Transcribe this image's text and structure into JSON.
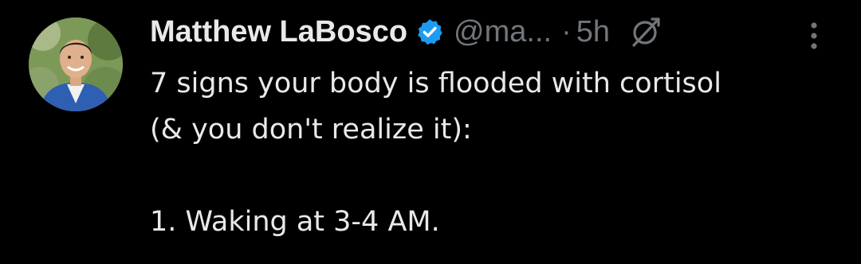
{
  "tweet": {
    "author": {
      "display_name": "Matthew LaBosco",
      "handle": "@ma...",
      "verified": true,
      "avatar_icon": "profile-photo-avatar"
    },
    "separator": "·",
    "time": "5h",
    "grok_icon": "grok-icon",
    "more_icon": "more-vertical-icon",
    "text_lines": [
      "7 signs your body is flooded with cortisol",
      "(& you don't realize it):",
      "",
      "1. Waking at 3-4 AM."
    ]
  },
  "colors": {
    "background": "#000000",
    "primary_text": "#e7e9ea",
    "secondary_text": "#71767b",
    "verified_blue": "#1d9bf0"
  }
}
